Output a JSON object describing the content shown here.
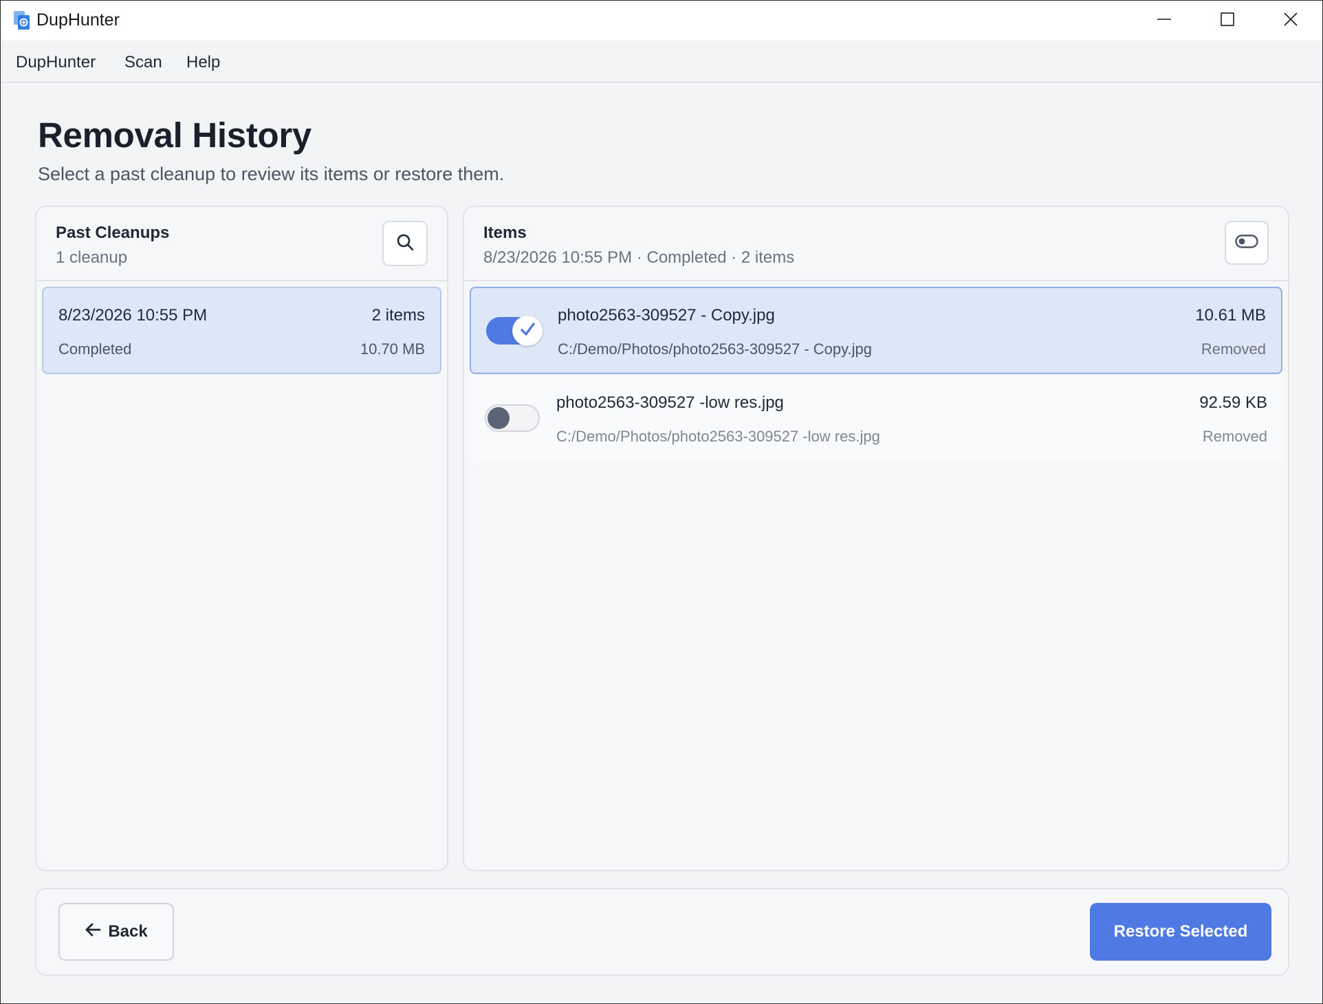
{
  "window": {
    "title": "DupHunter",
    "controls": {
      "minimize": "minimize-icon",
      "maximize": "maximize-icon",
      "close": "close-icon"
    }
  },
  "menu": {
    "items": [
      "DupHunter",
      "Scan",
      "Help"
    ]
  },
  "header": {
    "title": "Removal History",
    "subtitle": "Select a past cleanup to review its items or restore them."
  },
  "cleanups_panel": {
    "title": "Past Cleanups",
    "count_label": "1 cleanup",
    "search_icon": "search-icon",
    "items": [
      {
        "date": "8/23/2026 10:55 PM",
        "count": "2 items",
        "status": "Completed",
        "size": "10.70 MB",
        "selected": true
      }
    ]
  },
  "items_panel": {
    "title": "Items",
    "summary": "8/23/2026 10:55 PM · Completed · 2 items",
    "toggle_icon": "toggle-icon",
    "files": [
      {
        "name": "photo2563-309527 - Copy.jpg",
        "path": "C:/Demo/Photos/photo2563-309527 - Copy.jpg",
        "size": "10.61 MB",
        "status": "Removed",
        "checked": true
      },
      {
        "name": "photo2563-309527 -low res.jpg",
        "path": "C:/Demo/Photos/photo2563-309527 -low res.jpg",
        "size": "92.59 KB",
        "status": "Removed",
        "checked": false
      }
    ]
  },
  "footer": {
    "back_label": "Back",
    "restore_label": "Restore Selected"
  },
  "colors": {
    "accent": "#4f7ae3",
    "selected_bg": "#dde7f7",
    "background": "#f3f4f6"
  }
}
